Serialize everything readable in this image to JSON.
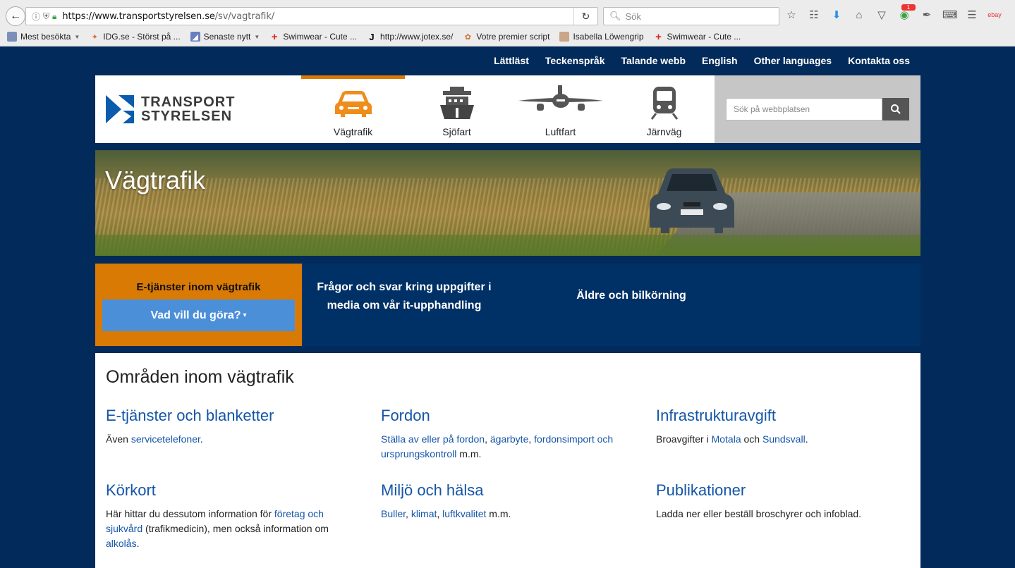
{
  "browser": {
    "url_host": "https://www.transportstyrelsen.se",
    "url_path": "/sv/vagtrafik/",
    "search_placeholder": "Sök",
    "bookmarks": [
      {
        "label": "Mest besökta",
        "icon": "folder-icon",
        "has_dropdown": true
      },
      {
        "label": "IDG.se - Störst på ...",
        "icon": "idg-icon",
        "has_dropdown": false
      },
      {
        "label": "Senaste nytt",
        "icon": "rss-icon",
        "has_dropdown": true
      },
      {
        "label": "Swimwear - Cute ...",
        "icon": "red-cross-icon",
        "has_dropdown": false
      },
      {
        "label": "http://www.jotex.se/",
        "icon": "jotex-icon",
        "has_dropdown": false
      },
      {
        "label": "Votre premier script",
        "icon": "script-icon",
        "has_dropdown": false
      },
      {
        "label": "Isabella Löwengrip",
        "icon": "avatar-icon",
        "has_dropdown": false
      },
      {
        "label": "Swimwear - Cute ...",
        "icon": "red-cross-icon",
        "has_dropdown": false
      }
    ],
    "notification_count": "1",
    "ebay_label": "ebay"
  },
  "toplinks": [
    "Lättläst",
    "Teckenspråk",
    "Talande webb",
    "English",
    "Other languages",
    "Kontakta oss"
  ],
  "logo": {
    "line1": "TRANSPORT",
    "line2": "STYRELSEN"
  },
  "nav": [
    {
      "label": "Vägtrafik",
      "icon": "car-icon",
      "active": true
    },
    {
      "label": "Sjöfart",
      "icon": "ship-icon",
      "active": false
    },
    {
      "label": "Luftfart",
      "icon": "airplane-icon",
      "active": false
    },
    {
      "label": "Järnväg",
      "icon": "train-icon",
      "active": false
    }
  ],
  "search": {
    "placeholder": "Sök på webbplatsen"
  },
  "hero": {
    "title": "Vägtrafik"
  },
  "promo": {
    "eservices_title": "E-tjänster inom vägtrafik",
    "button_label": "Vad vill du göra?",
    "link1": "Frågor och svar kring uppgifter i media om vår it-upphandling",
    "link2": "Äldre och bilkörning"
  },
  "areas": {
    "heading": "Områden inom vägtrafik",
    "a1": {
      "title": "E-tjänster och blanketter",
      "t1": "Även ",
      "l1": "servicetelefoner",
      "t2": "."
    },
    "a2": {
      "title": "Fordon",
      "l1": "Ställa av eller på fordon",
      "t1": ", ",
      "l2": "ägarbyte",
      "t2": ", ",
      "l3": "fordonsimport och ursprungskontroll",
      "t3": " m.m."
    },
    "a3": {
      "title": "Infrastrukturavgift",
      "t1": "Broavgifter i ",
      "l1": "Motala",
      "t2": " och ",
      "l2": "Sundsvall",
      "t3": "."
    },
    "a4": {
      "title": "Körkort",
      "t1": "Här hittar du dessutom information för ",
      "l1": "företag och sjukvård",
      "t2": " (trafikmedicin), men också information om ",
      "l2": "alkolås",
      "t3": "."
    },
    "a5": {
      "title": "Miljö och hälsa",
      "l1": "Buller",
      "t1": ", ",
      "l2": "klimat",
      "t2": ", ",
      "l3": "luftkvalitet",
      "t3": " m.m."
    },
    "a6": {
      "title": "Publikationer",
      "t1": "Ladda ner eller beställ broschyrer och infoblad."
    }
  },
  "colors": {
    "navy": "#022a5a",
    "orange": "#d97a04",
    "link_blue": "#1455a8",
    "button_blue": "#4c8fd9"
  }
}
